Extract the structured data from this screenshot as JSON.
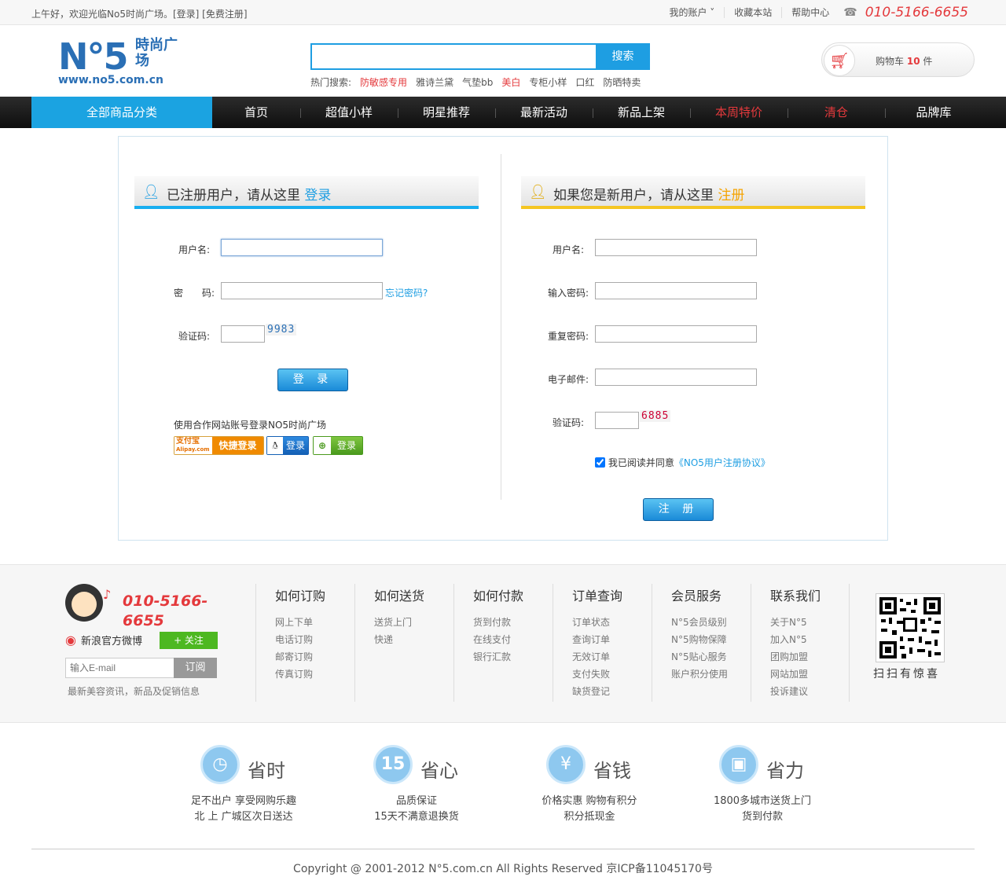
{
  "topbar": {
    "greeting": "上午好，欢迎光临No5时尚广场。[登录] [免费注册]",
    "links": [
      "我的账户 ˅",
      "收藏本站",
      "帮助中心"
    ],
    "phone": "010-5166-6655"
  },
  "header": {
    "logo_main": "N°5",
    "logo_cn": "時尚广场",
    "logo_url": "www.no5.com.cn",
    "search_placeholder": "",
    "search_button": "搜索",
    "hot_label": "热门搜索:",
    "hot_items": [
      {
        "label": "防敏感专用",
        "highlight": true
      },
      {
        "label": "雅诗兰黛",
        "highlight": false
      },
      {
        "label": "气垫bb",
        "highlight": false
      },
      {
        "label": "美白",
        "highlight": true
      },
      {
        "label": "专柜小样",
        "highlight": false
      },
      {
        "label": "口红",
        "highlight": false
      },
      {
        "label": "防晒特卖",
        "highlight": false
      }
    ],
    "cart_label": "购物车",
    "cart_count": "10",
    "cart_unit": "件"
  },
  "nav": {
    "all": "全部商品分类",
    "items": [
      {
        "label": "首页",
        "highlight": false
      },
      {
        "label": "超值小样",
        "highlight": false
      },
      {
        "label": "明星推荐",
        "highlight": false
      },
      {
        "label": "最新活动",
        "highlight": false
      },
      {
        "label": "新品上架",
        "highlight": false
      },
      {
        "label": "本周特价",
        "highlight": true
      },
      {
        "label": "清仓",
        "highlight": true
      },
      {
        "label": "品牌库",
        "highlight": false
      }
    ]
  },
  "login": {
    "heading_prefix": "已注册用户，请从这里",
    "heading_action": "登录",
    "username_label": "用户名:",
    "password_label": "密　　码:",
    "forgot": "忘记密码?",
    "captcha_label": "验证码:",
    "captcha_value": "9983",
    "submit": "登 录",
    "oauth_label": "使用合作网站账号登录NO5时尚广场",
    "oauth_alipay_brand": "支付宝",
    "oauth_alipay_sub": "Alipay.com",
    "oauth_alipay_action": "快捷登录",
    "oauth_qq": "登录",
    "oauth_other": "登录"
  },
  "register": {
    "heading_prefix": "如果您是新用户，请从这里",
    "heading_action": "注册",
    "username_label": "用户名:",
    "password_label": "输入密码:",
    "repeat_label": "重复密码:",
    "email_label": "电子邮件:",
    "captcha_label": "验证码:",
    "captcha_value": "6885",
    "agree_text": "我已阅读并同意",
    "agree_link": "《NO5用户注册协议》",
    "agree_checked": true,
    "submit": "注 册"
  },
  "footer": {
    "phone": "010-5166-6655",
    "weibo": "新浪官方微博",
    "follow": "+ 关注",
    "email_placeholder": "输入E-mail",
    "subscribe": "订阅",
    "note": "最新美容资讯，新品及促销信息",
    "columns": [
      {
        "title": "如何订购",
        "links": [
          "网上下单",
          "电话订购",
          "邮寄订购",
          "传真订购"
        ]
      },
      {
        "title": "如何送货",
        "links": [
          "送货上门",
          "快递"
        ]
      },
      {
        "title": "如何付款",
        "links": [
          "货到付款",
          "在线支付",
          "银行汇款"
        ]
      },
      {
        "title": "订单查询",
        "links": [
          "订单状态",
          "查询订单",
          "无效订单",
          "支付失败",
          "缺货登记"
        ]
      },
      {
        "title": "会员服务",
        "links": [
          "N°5会员级别",
          "N°5购物保障",
          "N°5贴心服务",
          "账户积分使用"
        ]
      },
      {
        "title": "联系我们",
        "links": [
          "关于N°5",
          "加入N°5",
          "团购加盟",
          "网站加盟",
          "投诉建议"
        ]
      }
    ],
    "qr_caption": "扫扫有惊喜"
  },
  "features": [
    {
      "icon": "◷",
      "name": "省时",
      "line1": "足不出户 享受网购乐趣",
      "line2": "北 上 广城区次日送达"
    },
    {
      "icon": "15",
      "name": "省心",
      "line1": "品质保证",
      "line2": "15天不满意退换货"
    },
    {
      "icon": "¥",
      "name": "省钱",
      "line1": "价格实惠 购物有积分",
      "line2": "积分抵现金"
    },
    {
      "icon": "▣",
      "name": "省力",
      "line1": "1800多城市送货上门",
      "line2": "货到付款"
    }
  ],
  "copyright": "Copyright @ 2001-2012 N°5.com.cn All Rights Reserved 京ICP备11045170号",
  "colors": {
    "accent": "#1e9ee2",
    "red": "#e4393c",
    "yellow": "#f5c622",
    "nav_bg": "#111111"
  }
}
